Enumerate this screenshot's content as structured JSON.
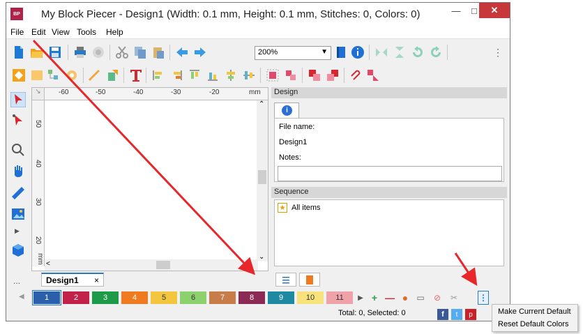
{
  "window": {
    "title": "My Block Piecer - Design1 (Width: 0.1 mm, Height: 0.1 mm, Stitches: 0, Colors: 0)",
    "logo": "BP",
    "minimize": "—",
    "maximize": "□",
    "close": "✕"
  },
  "menubar": [
    "File",
    "Edit",
    "View",
    "Tools",
    "Help"
  ],
  "toolbar": {
    "zoom_value": "200%",
    "overflow": "⋮"
  },
  "ruler": {
    "top_labels": [
      "-60",
      "-50",
      "-40",
      "-30",
      "-20",
      "mm"
    ],
    "left_labels": [
      "50",
      "40",
      "30",
      "20",
      "mm"
    ]
  },
  "document_tab": {
    "label": "Design1",
    "close": "×"
  },
  "design_panel": {
    "header": "Design",
    "file_name_label": "File name:",
    "file_name_value": "Design1",
    "notes_label": "Notes:",
    "notes_value": ""
  },
  "sequence_panel": {
    "header": "Sequence",
    "items": [
      "All items"
    ]
  },
  "left_tools": {
    "more": "..."
  },
  "colorbar": {
    "swatches": [
      {
        "label": "1",
        "color": "#2b5fab"
      },
      {
        "label": "2",
        "color": "#c2224a"
      },
      {
        "label": "3",
        "color": "#1f9a48"
      },
      {
        "label": "4",
        "color": "#f07a1f"
      },
      {
        "label": "5",
        "color": "#f3c640"
      },
      {
        "label": "6",
        "color": "#8dd06e"
      },
      {
        "label": "7",
        "color": "#c77c4a"
      },
      {
        "label": "8",
        "color": "#8b2a55"
      },
      {
        "label": "9",
        "color": "#1e8aa2"
      },
      {
        "label": "10",
        "color": "#f7e27c"
      },
      {
        "label": "11",
        "color": "#efa3a8"
      }
    ],
    "selected_label": "1"
  },
  "status": {
    "text": "Total: 0, Selected: 0"
  },
  "more_button": "⋮",
  "context_menu": {
    "items": [
      "Make Current Default",
      "Reset Default Colors"
    ]
  }
}
